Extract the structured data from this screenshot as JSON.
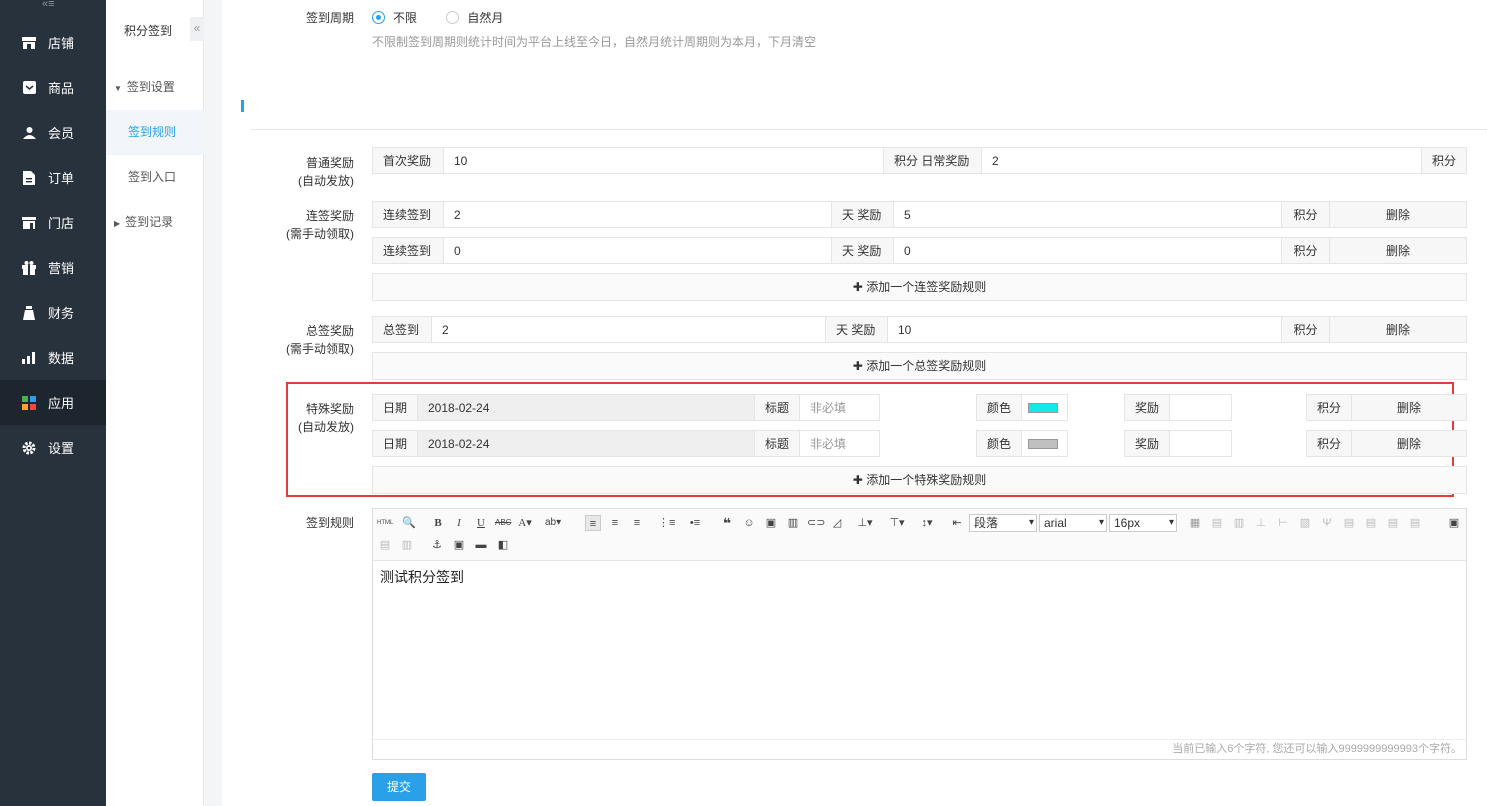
{
  "nav": {
    "collapse_icon": "«≡",
    "items": [
      {
        "label": "店铺",
        "icon": "shop-icon"
      },
      {
        "label": "商品",
        "icon": "goods-icon"
      },
      {
        "label": "会员",
        "icon": "member-icon"
      },
      {
        "label": "订单",
        "icon": "order-icon"
      },
      {
        "label": "门店",
        "icon": "store-icon"
      },
      {
        "label": "营销",
        "icon": "gift-icon"
      },
      {
        "label": "财务",
        "icon": "money-bag-icon"
      },
      {
        "label": "数据",
        "icon": "chart-icon"
      },
      {
        "label": "应用",
        "icon": "apps-icon"
      },
      {
        "label": "设置",
        "icon": "gear-icon"
      }
    ],
    "active": "应用"
  },
  "sub_nav": {
    "title": "积分签到",
    "toggle": "«",
    "groups": [
      {
        "label": "签到设置",
        "children": [
          "签到规则",
          "签到入口"
        ]
      },
      {
        "label": "签到记录",
        "children": []
      }
    ],
    "active": "签到规则"
  },
  "cycle": {
    "label": "签到周期",
    "options": [
      "不限",
      "自然月"
    ],
    "selected": "不限",
    "hint": "不限制签到周期则统计时间为平台上线至今日，自然月统计周期则为本月，下月清空"
  },
  "normal_reward": {
    "label1": "普通奖励",
    "label2": "(自动发放)",
    "first_label": "首次奖励",
    "first_value": "10",
    "mid_label": "积分 日常奖励",
    "daily_value": "2",
    "unit": "积分"
  },
  "streak_reward": {
    "label1": "连签奖励",
    "label2": "(需手动领取)",
    "rows": [
      {
        "prefix": "连续签到",
        "days": "2",
        "mid": "天 奖励",
        "points": "5",
        "unit": "积分",
        "delete": "删除"
      },
      {
        "prefix": "连续签到",
        "days": "0",
        "mid": "天 奖励",
        "points": "0",
        "unit": "积分",
        "delete": "删除"
      }
    ],
    "add_label": "添加一个连签奖励规则"
  },
  "total_reward": {
    "label1": "总签奖励",
    "label2": "(需手动领取)",
    "rows": [
      {
        "prefix": "总签到",
        "days": "2",
        "mid": "天 奖励",
        "points": "10",
        "unit": "积分",
        "delete": "删除"
      }
    ],
    "add_label": "添加一个总签奖励规则"
  },
  "special_reward": {
    "label1": "特殊奖励",
    "label2": "(自动发放)",
    "highlight_color": "#e83a3a",
    "rows": [
      {
        "date_label": "日期",
        "date": "2018-02-24",
        "title_label": "标题",
        "title_placeholder": "非必填",
        "color_label": "颜色",
        "color": "#14e8e8",
        "reward_label": "奖励",
        "reward": "",
        "unit": "积分",
        "delete": "删除"
      },
      {
        "date_label": "日期",
        "date": "2018-02-24",
        "title_label": "标题",
        "title_placeholder": "非必填",
        "color_label": "颜色",
        "color": "#c0c0c0",
        "reward_label": "奖励",
        "reward": "",
        "unit": "积分",
        "delete": "删除"
      }
    ],
    "add_label": "添加一个特殊奖励规则"
  },
  "rules": {
    "label": "签到规则",
    "paragraph_select": "段落",
    "font_select": "arial",
    "size_select": "16px",
    "content": "测试积分签到",
    "counter": "当前已输入6个字符, 您还可以输入9999999999993个字符。"
  },
  "submit_label": "提交",
  "accent": "#29a0e8"
}
